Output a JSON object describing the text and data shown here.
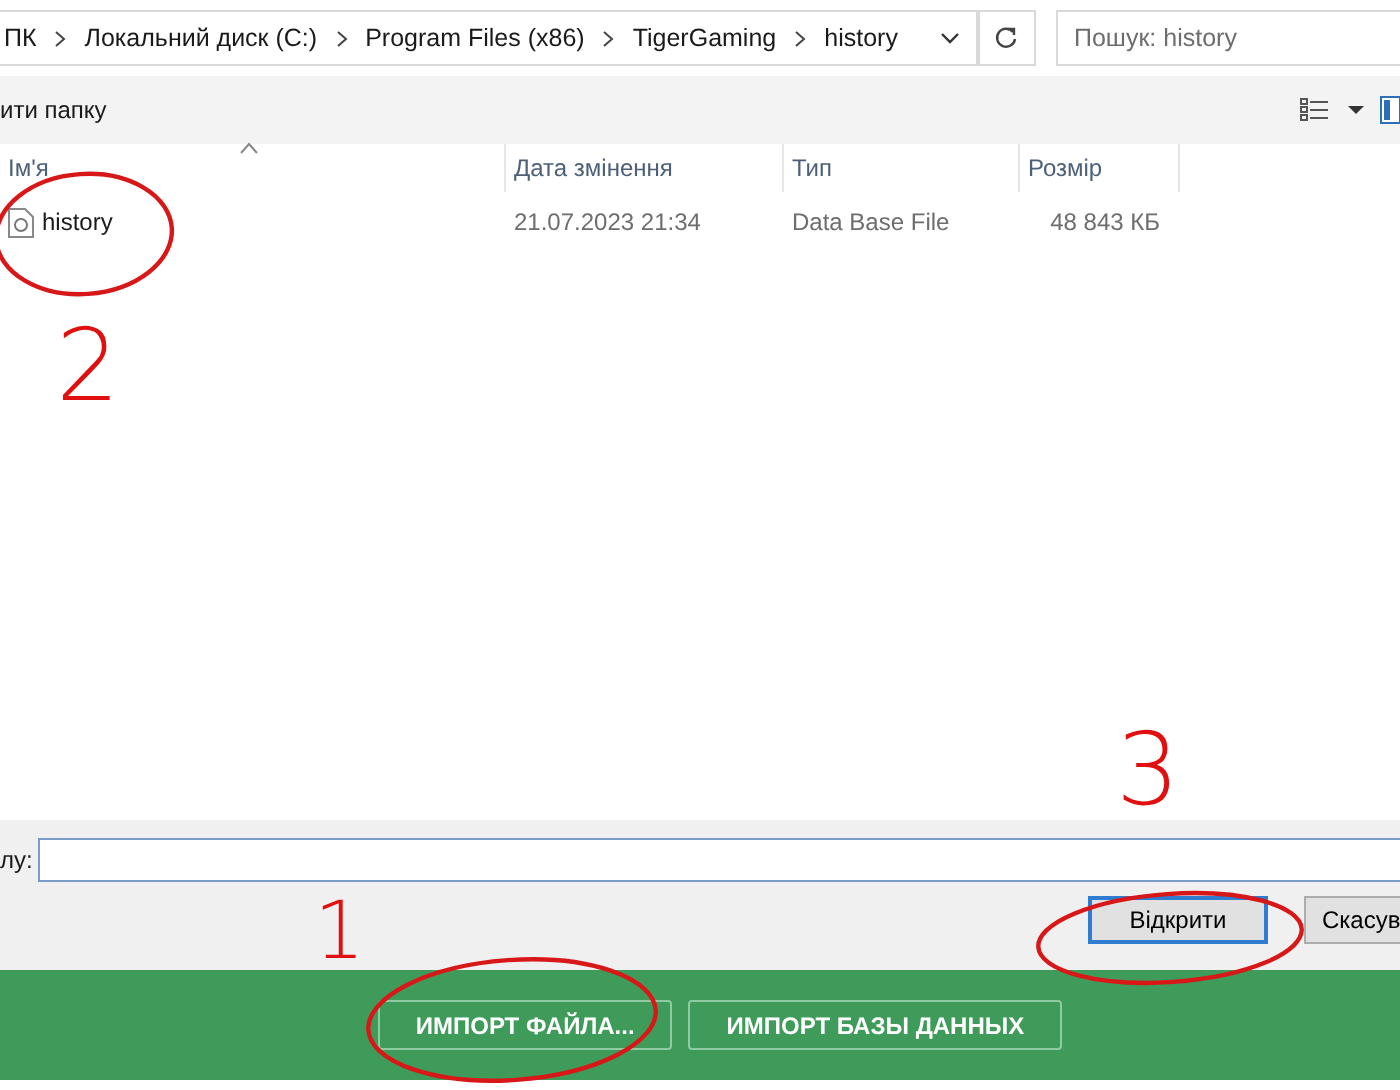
{
  "address_bar": {
    "path": [
      "ПК",
      "Локальний диск (C:)",
      "Program Files (x86)",
      "TigerGaming",
      "history"
    ]
  },
  "search": {
    "placeholder": "Пошук: history"
  },
  "toolbar": {
    "label": "ити папку"
  },
  "table": {
    "columns": [
      {
        "label": "Ім'я",
        "sorted": true
      },
      {
        "label": "Дата змінення",
        "sorted": false
      },
      {
        "label": "Тип",
        "sorted": false
      },
      {
        "label": "Розмір",
        "sorted": false
      }
    ],
    "rows": [
      {
        "name": "history",
        "date": "21.07.2023 21:34",
        "type": "Data Base File",
        "size": "48 843 КБ"
      }
    ]
  },
  "file_name": {
    "label": "лу:"
  },
  "dialog_buttons": [
    {
      "label": "Відкрити",
      "default": true
    },
    {
      "label": "Скасув",
      "default": false
    }
  ],
  "app_buttons": [
    {
      "label": "ИМПОРТ ФАЙЛА..."
    },
    {
      "label": "ИМПОРТ БАЗЫ ДАННЫХ"
    }
  ],
  "annotations": [
    {
      "label": "2"
    },
    {
      "label": "3"
    },
    {
      "label": "1"
    }
  ]
}
